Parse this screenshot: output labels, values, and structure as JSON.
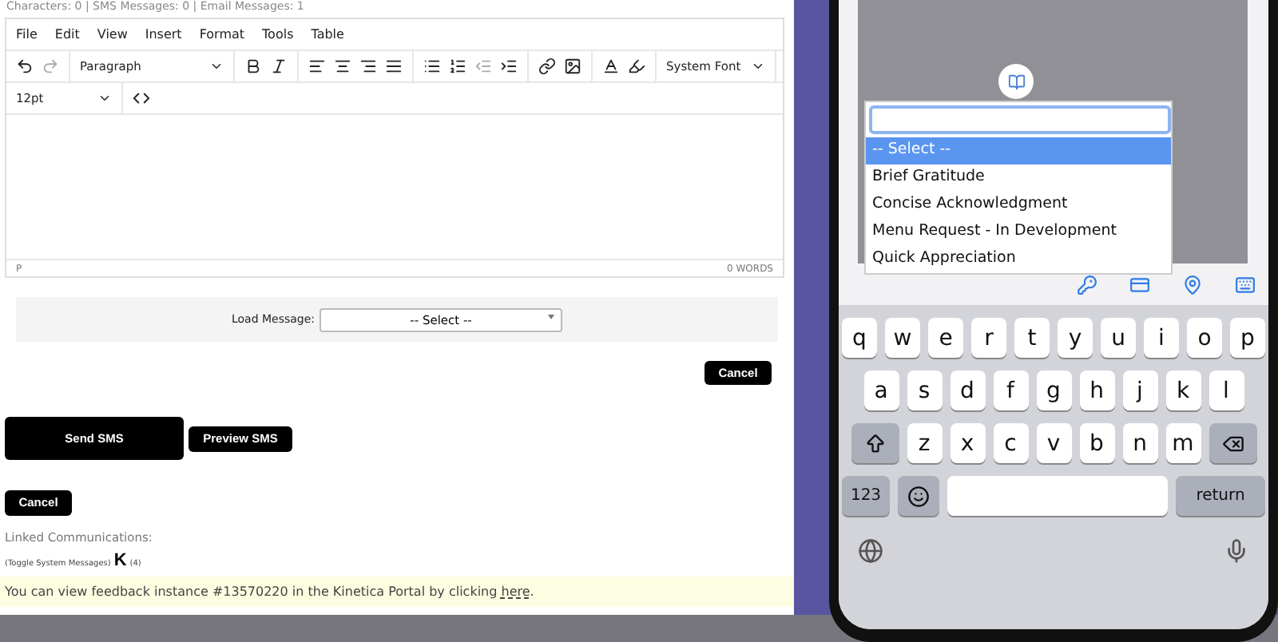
{
  "counter_line": "Characters: 0 | SMS Messages: 0 | Email Messages: 1",
  "editor": {
    "menu": [
      "File",
      "Edit",
      "View",
      "Insert",
      "Format",
      "Tools",
      "Table"
    ],
    "block_format": "Paragraph",
    "font_family": "System Font",
    "font_size": "12pt",
    "path": "P",
    "word_count": "0 WORDS"
  },
  "load_message": {
    "label": "Load Message:",
    "value": "-- Select --"
  },
  "cancel_top": "Cancel",
  "send": "Send SMS",
  "preview": "Preview SMS",
  "cancel": "Cancel",
  "linked": {
    "label": "Linked Communications:",
    "toggle": "(Toggle System Messages)",
    "logo": "K",
    "count": "(4)"
  },
  "notice": {
    "text": "You can view feedback instance #13570220 in the Kinetica Portal by clicking ",
    "link": "here",
    "end": "."
  },
  "phone": {
    "options": [
      {
        "label": "-- Select --",
        "selected": true
      },
      {
        "label": "Brief Gratitude",
        "selected": false
      },
      {
        "label": "Concise Acknowledgment",
        "selected": false
      },
      {
        "label": "Menu Request - In Development",
        "selected": false
      },
      {
        "label": "Quick Appreciation",
        "selected": false
      }
    ],
    "keyboard": [
      {
        "keys": [
          {
            "kind": "letter",
            "label": "q"
          },
          {
            "kind": "letter",
            "label": "w"
          },
          {
            "kind": "letter",
            "label": "e"
          },
          {
            "kind": "letter",
            "label": "r"
          },
          {
            "kind": "letter",
            "label": "t"
          },
          {
            "kind": "letter",
            "label": "y"
          },
          {
            "kind": "letter",
            "label": "u"
          },
          {
            "kind": "letter",
            "label": "i"
          },
          {
            "kind": "letter",
            "label": "o"
          },
          {
            "kind": "letter",
            "label": "p"
          }
        ]
      },
      {
        "keys": [
          {
            "kind": "letter",
            "label": "a"
          },
          {
            "kind": "letter",
            "label": "s"
          },
          {
            "kind": "letter",
            "label": "d"
          },
          {
            "kind": "letter",
            "label": "f"
          },
          {
            "kind": "letter",
            "label": "g"
          },
          {
            "kind": "letter",
            "label": "h"
          },
          {
            "kind": "letter",
            "label": "j"
          },
          {
            "kind": "letter",
            "label": "k"
          },
          {
            "kind": "letter",
            "label": "l"
          }
        ]
      },
      {
        "keys": [
          {
            "kind": "shift"
          },
          {
            "kind": "letter",
            "label": "z"
          },
          {
            "kind": "letter",
            "label": "x"
          },
          {
            "kind": "letter",
            "label": "c"
          },
          {
            "kind": "letter",
            "label": "v"
          },
          {
            "kind": "letter",
            "label": "b"
          },
          {
            "kind": "letter",
            "label": "n"
          },
          {
            "kind": "letter",
            "label": "m"
          },
          {
            "kind": "backspace"
          }
        ]
      },
      {
        "keys": [
          {
            "kind": "mode",
            "label": "123"
          },
          {
            "kind": "emoji"
          },
          {
            "kind": "space"
          },
          {
            "kind": "action",
            "label": "return"
          }
        ]
      }
    ]
  }
}
